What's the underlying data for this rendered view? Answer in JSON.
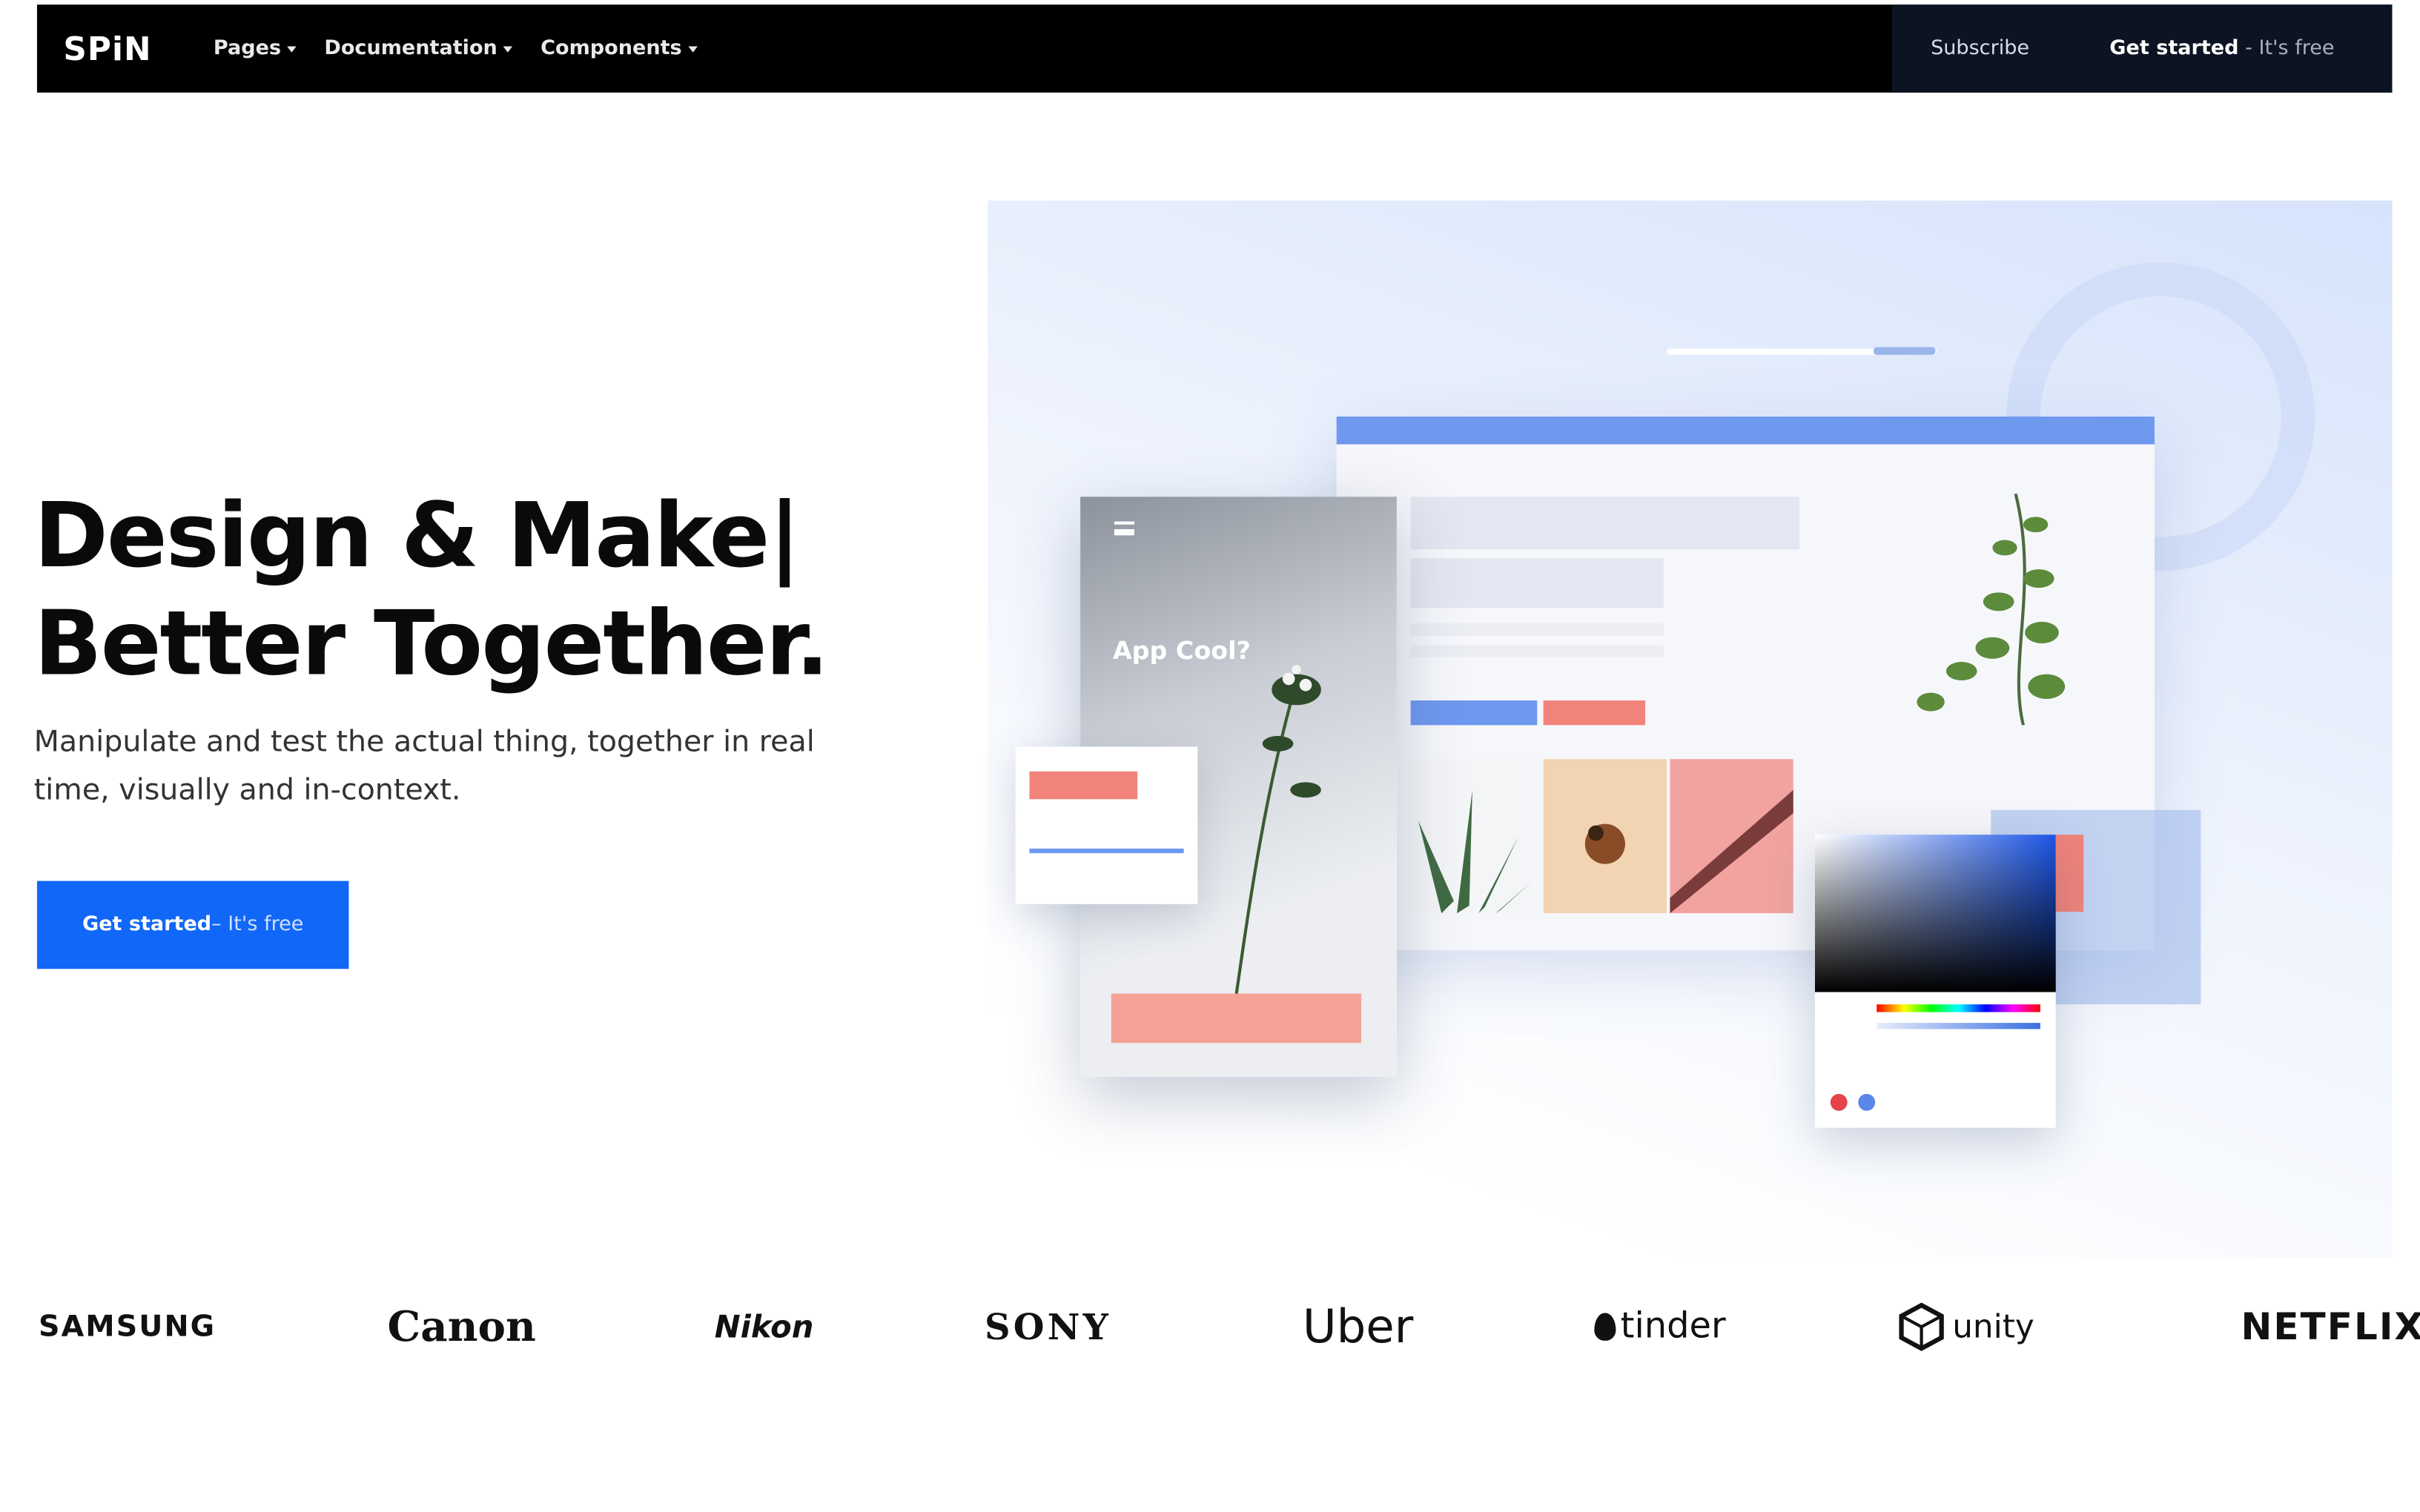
{
  "navbar": {
    "brand": "SPiN",
    "links": [
      {
        "label": "Pages"
      },
      {
        "label": "Documentation"
      },
      {
        "label": "Components"
      }
    ],
    "subscribe": "Subscribe",
    "get_started_bold": "Get started",
    "get_started_rest": " - It's free"
  },
  "hero": {
    "title_line1": "Design & Make|",
    "title_line2": "Better Together.",
    "subtitle": "Manipulate and test the actual thing, together in real time, visually and in-context.",
    "cta_bold": "Get started",
    "cta_rest": " – It's free"
  },
  "illustration": {
    "phone_title": "App Cool?"
  },
  "logos": [
    "SAMSUNG",
    "Canon",
    "Nikon",
    "SONY",
    "Uber",
    "tinder",
    "unity",
    "NETFLIX"
  ],
  "colors": {
    "navbar_bg": "#000000",
    "cta_blue": "#1167f7",
    "accent_blue": "#6f98ef",
    "accent_salmon": "#f1837b"
  }
}
